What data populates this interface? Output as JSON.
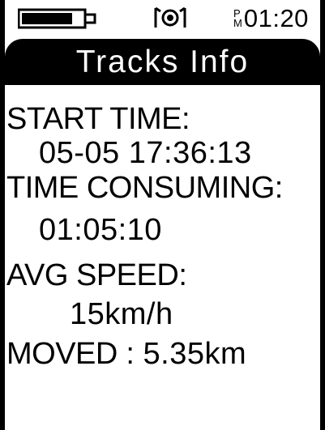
{
  "status_bar": {
    "battery_icon": "battery-icon",
    "signal_icon": "gps-signal-icon",
    "clock": {
      "ampm_top": "P",
      "ampm_bottom": "M",
      "time": "01:20"
    }
  },
  "header": {
    "title": "Tracks Info"
  },
  "tracks": {
    "start_time_label": "START TIME",
    "start_time_value": "05-05 17:36:13",
    "time_consuming_label": "TIME CONSUMING",
    "time_consuming_value": "01:05:10",
    "avg_speed_label": "AVG SPEED",
    "avg_speed_value": "15km/h",
    "moved_label": "MOVED",
    "moved_value": "5.35km",
    "separator": ":"
  }
}
